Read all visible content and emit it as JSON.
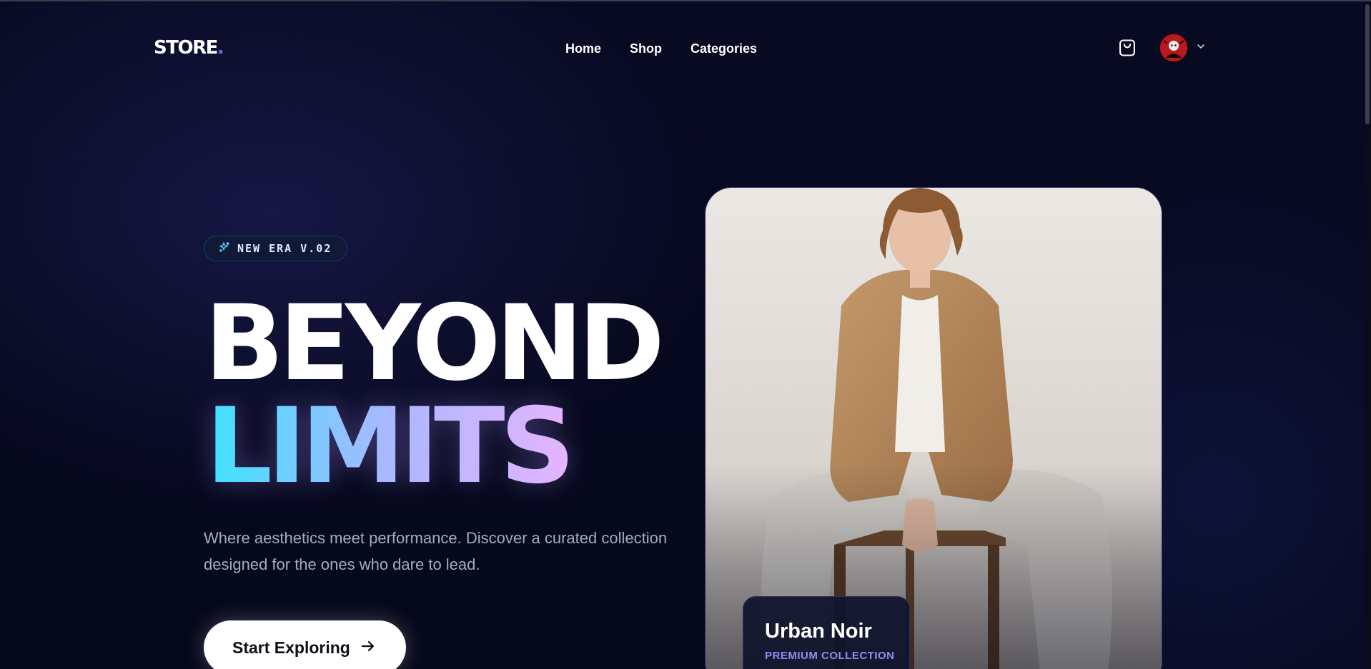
{
  "header": {
    "logo_text": "STORE",
    "logo_dot": ".",
    "nav": [
      {
        "label": "Home"
      },
      {
        "label": "Shop"
      },
      {
        "label": "Categories"
      }
    ],
    "cart_icon": "shopping-bag-icon",
    "avatar_icon": "user-avatar",
    "chevron_icon": "chevron-down-icon"
  },
  "hero": {
    "badge": {
      "icon": "sparkle-icon",
      "label": "NEW ERA V.02"
    },
    "title_line1": "BEYOND",
    "title_line2": "LIMITS",
    "description": "Where aesthetics meet performance. Discover a curated collection designed for the ones who dare to lead.",
    "cta": {
      "label": "Start Exploring",
      "icon": "arrow-right-icon"
    },
    "feature_card": {
      "title": "Urban Noir",
      "subtitle": "PREMIUM COLLECTION"
    }
  },
  "colors": {
    "background": "#060818",
    "accent": "#6f6cf0",
    "gradient_start": "#3ee3ff",
    "gradient_end": "#e6b4ff",
    "subtitle_accent": "#8d8ff2"
  }
}
